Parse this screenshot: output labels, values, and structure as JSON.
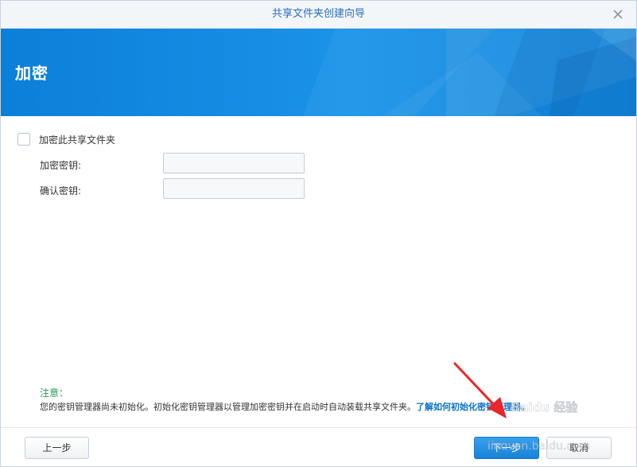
{
  "window": {
    "title": "共享文件夹创建向导"
  },
  "banner": {
    "title": "加密"
  },
  "form": {
    "encrypt_checkbox_label": "加密此共享文件夹",
    "encrypt_checked": false,
    "key_label": "加密密钥:",
    "key_value": "",
    "confirm_label": "确认密钥:",
    "confirm_value": ""
  },
  "note": {
    "title": "注意：",
    "text": "您的密钥管理器尚未初始化。初始化密钥管理器以管理加密密钥并在启动时自动装载共享文件夹。",
    "link": "了解如何初始化密钥管理器。"
  },
  "footer": {
    "prev_label": "上一步",
    "next_label": "下一步",
    "cancel_label": "取消"
  },
  "watermark": {
    "text": "jingyan.baidu.com",
    "logo_text": "Baidu 经验"
  },
  "colors": {
    "accent": "#1783d8",
    "link": "#0c72c6",
    "note_title": "#239b56",
    "annotation_arrow": "#e8262b"
  }
}
